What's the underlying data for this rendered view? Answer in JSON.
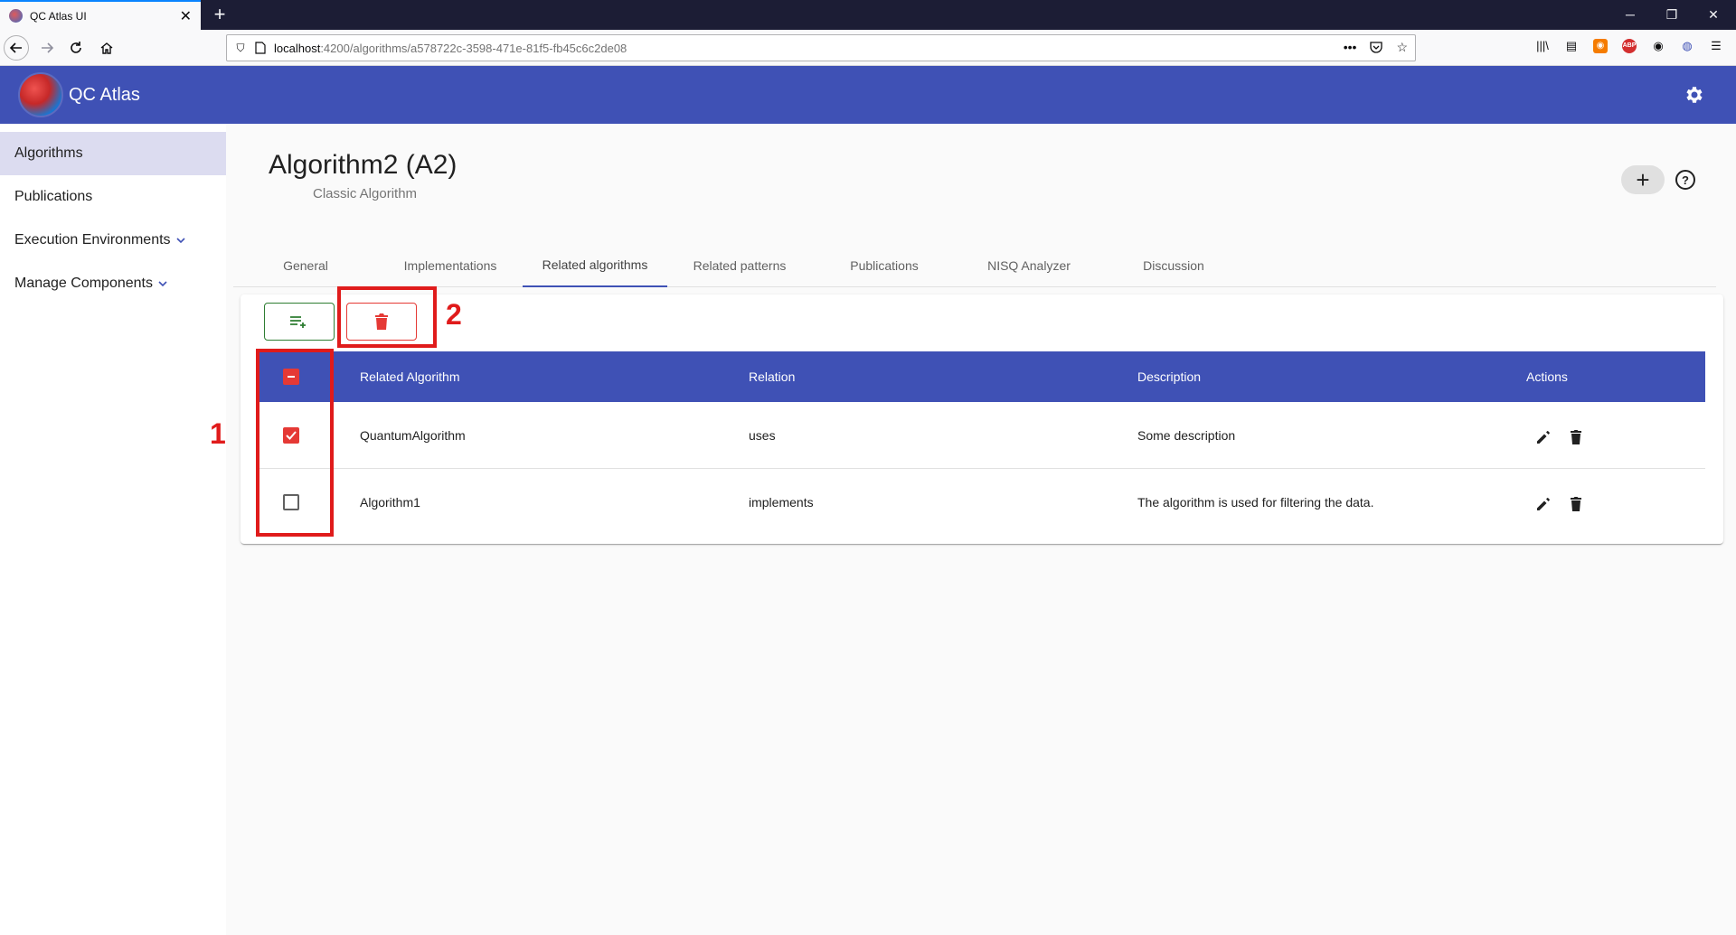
{
  "browser": {
    "tab_title": "QC Atlas UI",
    "new_tab": "+",
    "url_host": "localhost",
    "url_path": ":4200/algorithms/a578722c-3598-471e-81f5-fb45c6c2de08",
    "url_more": "•••"
  },
  "app": {
    "title": "QC Atlas",
    "accent": "#3f51b5"
  },
  "sidebar": {
    "items": [
      {
        "label": "Algorithms"
      },
      {
        "label": "Publications"
      },
      {
        "label": "Execution Environments"
      },
      {
        "label": "Manage Components"
      }
    ]
  },
  "page": {
    "title": "Algorithm2 (A2)",
    "subtitle": "Classic Algorithm",
    "add_label": "+",
    "help_label": "?"
  },
  "tabs": [
    {
      "label": "General"
    },
    {
      "label": "Implementations"
    },
    {
      "label": "Related algorithms"
    },
    {
      "label": "Related patterns"
    },
    {
      "label": "Publications"
    },
    {
      "label": "NISQ Analyzer"
    },
    {
      "label": "Discussion"
    }
  ],
  "table": {
    "headers": {
      "related": "Related Algorithm",
      "relation": "Relation",
      "description": "Description",
      "actions": "Actions"
    },
    "rows": [
      {
        "name": "QuantumAlgorithm",
        "relation": "uses",
        "description": "Some description",
        "checked": true
      },
      {
        "name": "Algorithm1",
        "relation": "implements",
        "description": "The algorithm is used for filtering the data.",
        "checked": false
      }
    ]
  },
  "annotations": {
    "one": "1",
    "two": "2",
    "color": "#e01b1b"
  }
}
